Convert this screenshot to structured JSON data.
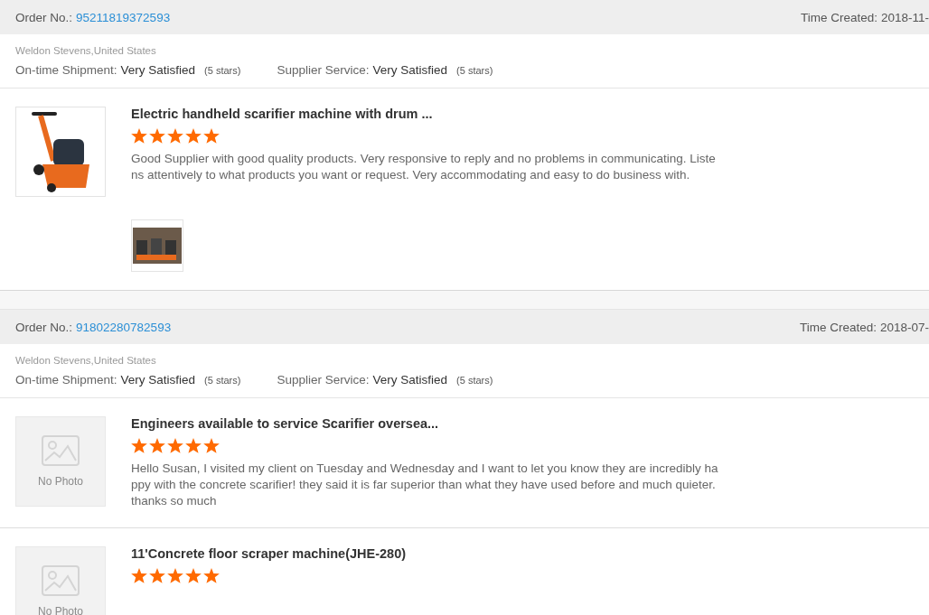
{
  "orders": [
    {
      "order_label": "Order No.:",
      "order_number": "95211819372593",
      "time_label": "Time Created:",
      "time_value": "2018-11-",
      "buyer": "Weldon Stevens,United States",
      "ratings": [
        {
          "label": "On-time Shipment:",
          "value": "Very Satisfied",
          "note": "(5 stars)"
        },
        {
          "label": "Supplier Service:",
          "value": "Very Satisfied",
          "note": "(5 stars)"
        }
      ],
      "items": [
        {
          "kind": "photo",
          "title": "Electric handheld scarifier machine with drum ...",
          "stars": 5,
          "review": "Good Supplier with good quality products. Very responsive to reply and no problems in communicating. Listens attentively to what products you want or request. Very accommodating and easy to do business with.",
          "attachments": [
            {
              "kind": "photo"
            }
          ]
        }
      ]
    },
    {
      "order_label": "Order No.:",
      "order_number": "91802280782593",
      "time_label": "Time Created:",
      "time_value": "2018-07-",
      "buyer": "Weldon Stevens,United States",
      "ratings": [
        {
          "label": "On-time Shipment:",
          "value": "Very Satisfied",
          "note": "(5 stars)"
        },
        {
          "label": "Supplier Service:",
          "value": "Very Satisfied",
          "note": "(5 stars)"
        }
      ],
      "items": [
        {
          "kind": "no_photo",
          "placeholder_text": "No Photo",
          "title": "Engineers available to service Scarifier oversea...",
          "stars": 5,
          "review": "Hello Susan, I visited my client on Tuesday and Wednesday and I want to let you know they are incredibly happy with the concrete scarifier! they said it is far superior than what they have used before and much quieter.  thanks so much"
        },
        {
          "kind": "no_photo",
          "placeholder_text": "No Photo",
          "title": "11'Concrete floor scraper machine(JHE-280)",
          "stars": 5
        }
      ]
    }
  ]
}
